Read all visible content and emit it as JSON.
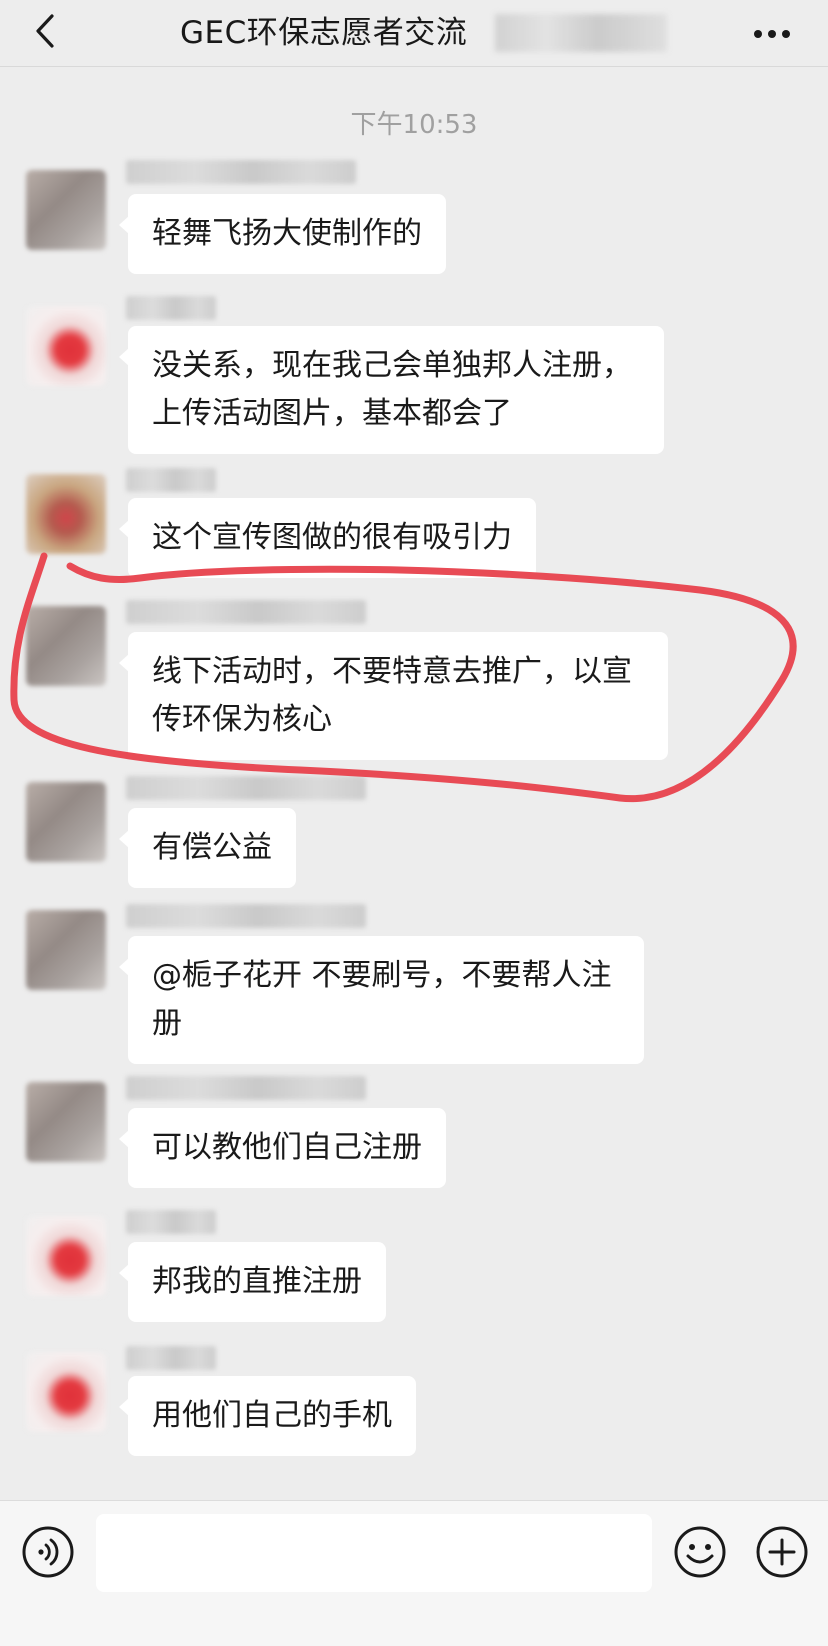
{
  "header": {
    "title": "GEC环保志愿者交流",
    "back_icon": "chevron-left-icon",
    "more_icon": "more-dots-icon"
  },
  "timestamp": "下午10:53",
  "messages": [
    {
      "text": "轻舞飞扬大使制作的",
      "avatar_style": "gray"
    },
    {
      "text": "没关系，现在我己会单独邦人注册，上传活动图片，基本都会了",
      "avatar_style": "red"
    },
    {
      "text": "这个宣传图做的很有吸引力",
      "avatar_style": "brown"
    },
    {
      "text": "线下活动时，不要特意去推广，以宣传环保为核心",
      "avatar_style": "gray"
    },
    {
      "text": "有偿公益",
      "avatar_style": "gray"
    },
    {
      "text": "@栀子花开 不要刷号，不要帮人注册",
      "avatar_style": "gray"
    },
    {
      "text": "可以教他们自己注册",
      "avatar_style": "gray"
    },
    {
      "text": "邦我的直推注册",
      "avatar_style": "red"
    },
    {
      "text": "用他们自己的手机",
      "avatar_style": "red"
    }
  ],
  "annotation": {
    "color": "#e84b55",
    "highlighted_message_index": 3
  },
  "input_bar": {
    "voice_icon": "voice-icon",
    "emoji_icon": "emoji-icon",
    "plus_icon": "plus-icon",
    "input_value": ""
  }
}
